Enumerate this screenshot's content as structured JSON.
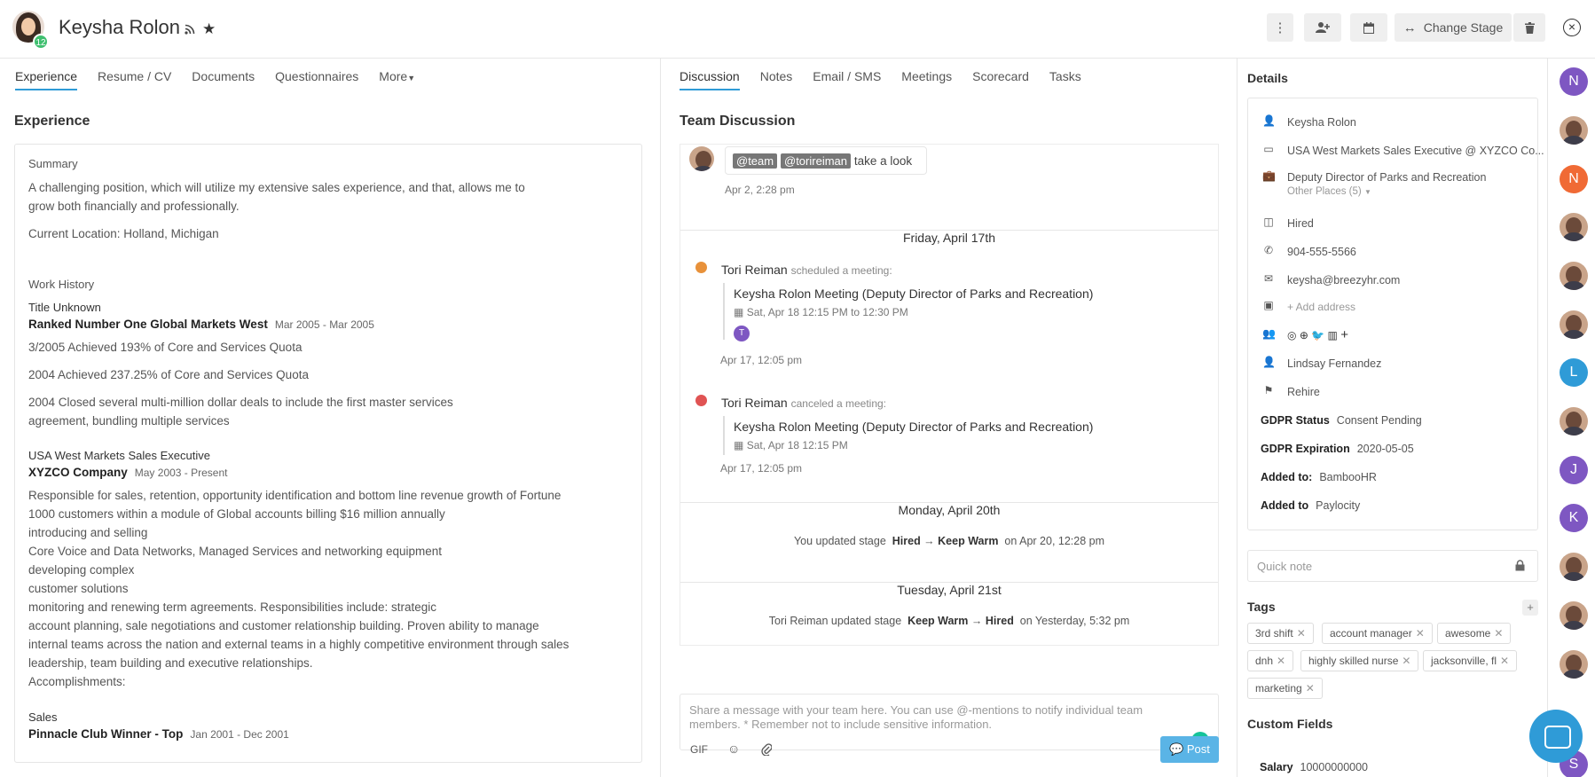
{
  "candidate": {
    "name": "Keysha Rolon",
    "score": "12"
  },
  "header": {
    "change_stage_label": "Change Stage"
  },
  "left_tabs": [
    "Experience",
    "Resume / CV",
    "Documents",
    "Questionnaires",
    "More"
  ],
  "middle_tabs": [
    "Discussion",
    "Notes",
    "Email / SMS",
    "Meetings",
    "Scorecard",
    "Tasks"
  ],
  "experience": {
    "section_title": "Experience",
    "summary_label": "Summary",
    "summary_lines": [
      "A challenging position, which will utilize my extensive sales experience, and that, allows me to",
      "grow both financially and professionally."
    ],
    "location": "Current Location: Holland, Michigan",
    "work_history_label": "Work History",
    "jobs": [
      {
        "title": "Title Unknown",
        "company": "Ranked Number One Global Markets West",
        "dates": "Mar 2005 - Mar 2005",
        "lines": [
          "3/2005 Achieved 193% of Core and Services Quota",
          "2004 Achieved 237.25% of Core and Services Quota",
          "2004 Closed several multi-million dollar deals to include the first master services",
          "agreement, bundling multiple services"
        ]
      },
      {
        "title": "USA West Markets Sales Executive",
        "company": "XYZCO Company",
        "dates": "May 2003 - Present",
        "lines": [
          "Responsible for sales, retention, opportunity identification and bottom line revenue growth of Fortune",
          "1000 customers within a module of Global accounts billing $16 million annually",
          "introducing and selling",
          "Core Voice and Data Networks, Managed Services and networking equipment",
          "developing complex",
          "customer solutions",
          "monitoring and renewing term agreements. Responsibilities include: strategic",
          "account planning, sale negotiations and customer relationship building. Proven ability to manage",
          "internal teams across the nation and external teams in a highly competitive environment through sales",
          "leadership, team building and executive relationships.",
          "Accomplishments:"
        ]
      },
      {
        "title": "Sales",
        "company": "Pinnacle Club Winner - Top",
        "dates": "Jan 2001 - Dec 2001"
      }
    ]
  },
  "discussion": {
    "section_title": "Team Discussion",
    "first_message": {
      "mentions": [
        "@team",
        "@torireiman"
      ],
      "text": "take a look",
      "time": "Apr 2, 2:28 pm"
    },
    "date_headers": [
      "Friday, April 17th",
      "Monday, April 20th",
      "Tuesday, April 21st"
    ],
    "events": [
      {
        "actor": "Tori Reiman",
        "action": "scheduled a meeting:",
        "title": "Keysha Rolon Meeting (Deputy Director of Parks and Recreation)",
        "when": "Sat, Apr 18 12:15 PM to 12:30 PM",
        "attendee": "T",
        "time": "Apr 17, 12:05 pm",
        "color": "#e8913a"
      },
      {
        "actor": "Tori Reiman",
        "action": "canceled a meeting:",
        "title": "Keysha Rolon Meeting (Deputy Director of Parks and Recreation)",
        "when": "Sat, Apr 18 12:15 PM",
        "time": "Apr 17, 12:05 pm",
        "color": "#e05353"
      }
    ],
    "stage_updates": [
      {
        "prefix": "You updated stage",
        "from": "Hired",
        "to": "Keep Warm",
        "suffix": "on Apr 20, 12:28 pm"
      },
      {
        "prefix": "Tori Reiman updated stage",
        "from": "Keep Warm",
        "to": "Hired",
        "suffix": "on Yesterday, 5:32 pm"
      }
    ],
    "composer_placeholder": "Share a message with your team here. You can use @-mentions to notify individual team members. * Remember not to include sensitive information.",
    "gif_label": "GIF",
    "post_label": "Post"
  },
  "details": {
    "section_title": "Details",
    "name": "Keysha Rolon",
    "position": "USA West Markets Sales Executive @ XYZCO Co...",
    "applied_job": "Deputy Director of Parks and Recreation",
    "other_places": "Other Places (5)",
    "stage": "Hired",
    "phone": "904-555-5566",
    "email": "keysha@breezyhr.com",
    "add_address": "+ Add address",
    "social_plus": "+",
    "owner": "Lindsay Fernandez",
    "source": "Rehire",
    "gdpr_status_label": "GDPR Status",
    "gdpr_status": "Consent Pending",
    "gdpr_expiration_label": "GDPR Expiration",
    "gdpr_expiration": "2020-05-05",
    "added_to_1_label": "Added to:",
    "added_to_1": "BambooHR",
    "added_to_2_label": "Added to",
    "added_to_2": "Paylocity"
  },
  "quick_note_placeholder": "Quick note",
  "tags": {
    "title": "Tags",
    "add": "+",
    "items": [
      "3rd shift",
      "account manager",
      "awesome",
      "dnh",
      "highly skilled nurse",
      "jacksonville, fl",
      "marketing"
    ]
  },
  "custom_fields": {
    "title": "Custom Fields",
    "salary_label": "Salary",
    "salary": "10000000000"
  },
  "team_avatars": [
    {
      "letter": "N",
      "color": "#7e57c2"
    },
    {
      "letter": "",
      "color": "photo"
    },
    {
      "letter": "N",
      "color": "#f06a35"
    },
    {
      "letter": "",
      "color": "photo"
    },
    {
      "letter": "",
      "color": "photo"
    },
    {
      "letter": "",
      "color": "photo"
    },
    {
      "letter": "L",
      "color": "#2f9bd7"
    },
    {
      "letter": "",
      "color": "photo"
    },
    {
      "letter": "J",
      "color": "#7e57c2"
    },
    {
      "letter": "K",
      "color": "#7e57c2"
    },
    {
      "letter": "",
      "color": "photo"
    },
    {
      "letter": "",
      "color": "photo"
    },
    {
      "letter": "",
      "color": "photo"
    },
    {
      "letter": "S",
      "color": "#7e57c2"
    }
  ]
}
